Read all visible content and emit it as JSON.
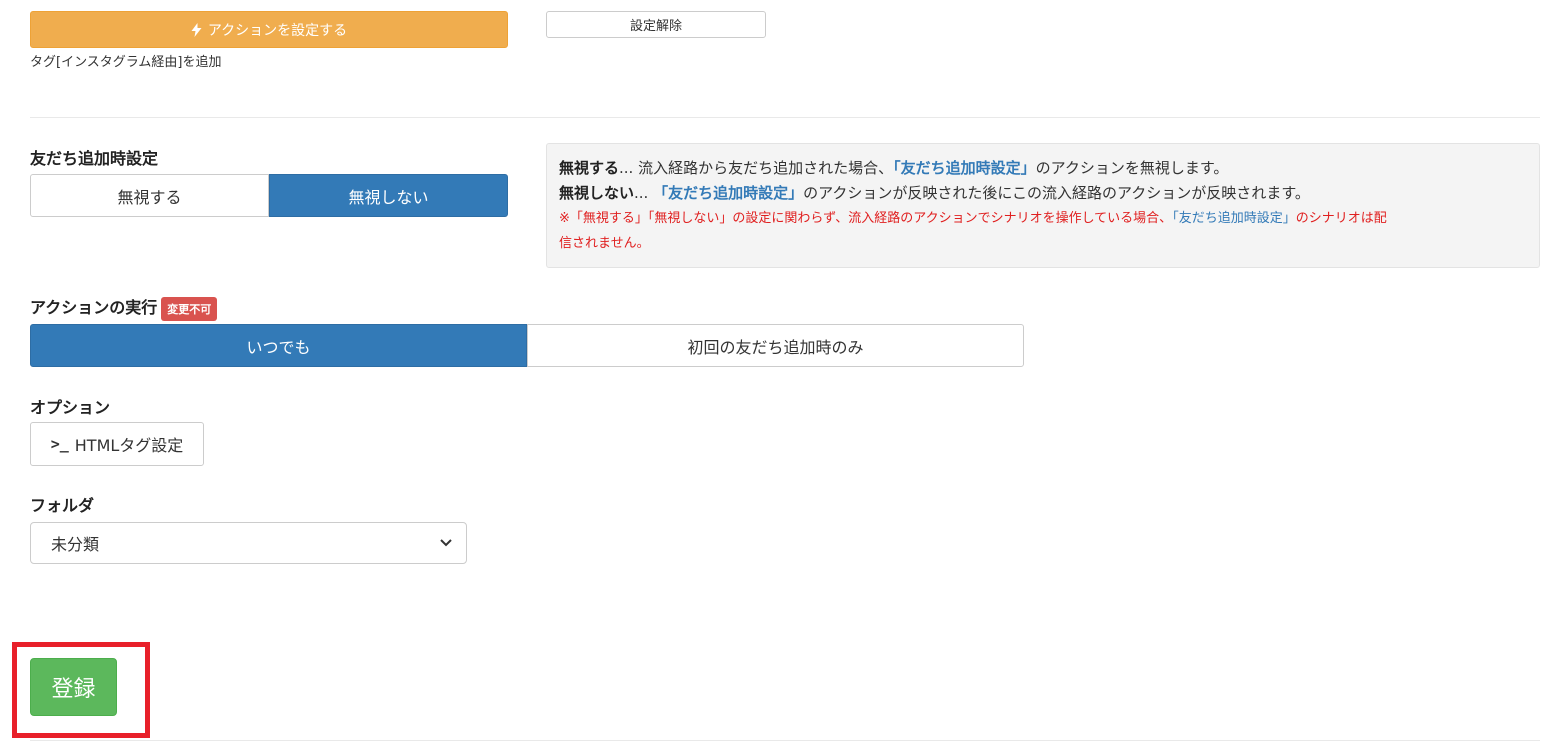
{
  "action": {
    "set_button_label": "アクションを設定する",
    "clear_button_label": "設定解除",
    "summary": "タグ[インスタグラム経由]を追加"
  },
  "friend_add_setting": {
    "label": "友だち追加時設定",
    "options": [
      "無視する",
      "無視しない"
    ],
    "selected": "無視しない",
    "info": {
      "line1_term": "無視する",
      "line1_ellipsis": "... ",
      "line1_text_a": "流入経路から友だち追加された場合、",
      "line1_highlight": "「友だち追加時設定」",
      "line1_text_b": "のアクションを無視します。",
      "line2_term": "無視しない",
      "line2_ellipsis": "... ",
      "line2_highlight": "「友だち追加時設定」",
      "line2_text": "のアクションが反映された後にこの流入経路のアクションが反映されます。",
      "note_a": "※「無視する」「無視しない」の設定に関わらず、流入経路のアクションでシナリオを操作している場合、",
      "note_highlight": "「友だち追加時設定」",
      "note_b": "のシナリオは配",
      "note_line2": "信されません。"
    }
  },
  "action_execution": {
    "label": "アクションの実行",
    "badge": "変更不可",
    "options": [
      "いつでも",
      "初回の友だち追加時のみ"
    ],
    "selected": "いつでも"
  },
  "options_section": {
    "label": "オプション",
    "html_tag_button_label": "HTMLタグ設定"
  },
  "folder": {
    "label": "フォルダ",
    "selected_value": "未分類"
  },
  "submit": {
    "label": "登録"
  },
  "colors": {
    "warning": "#f0ad4e",
    "primary": "#337ab7",
    "success": "#5cb85c",
    "danger": "#d9534f",
    "highlight_frame": "#e8202a",
    "note_text": "#e02020"
  }
}
